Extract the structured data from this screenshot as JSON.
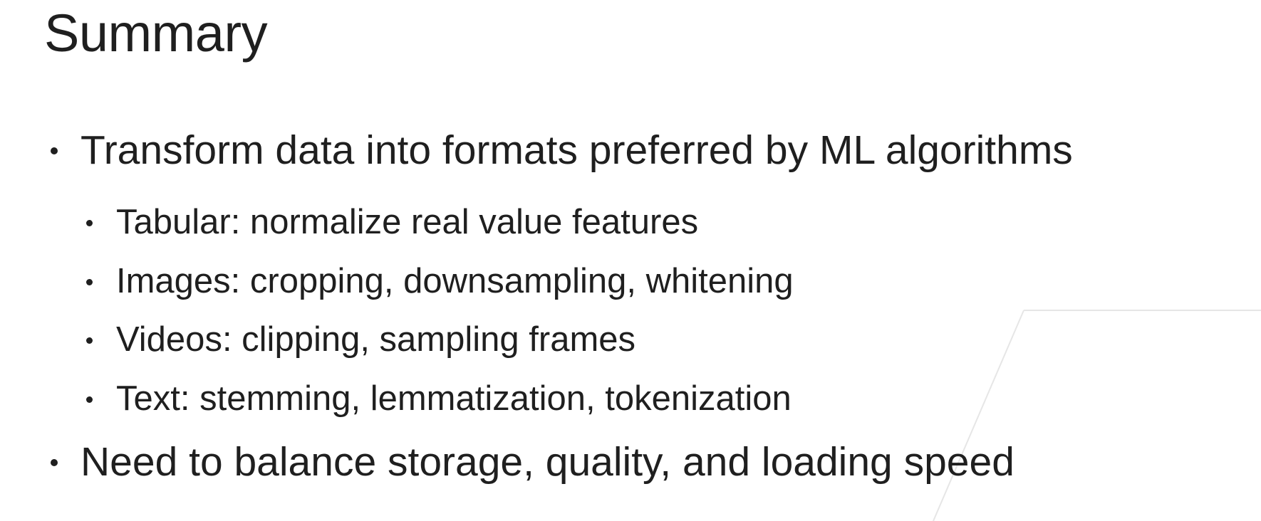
{
  "slide": {
    "title": "Summary",
    "bullets": [
      {
        "text": "Transform data into formats preferred by ML algorithms"
      },
      {
        "text": "Tabular: normalize real value features"
      },
      {
        "text": "Images: cropping, downsampling, whitening"
      },
      {
        "text": "Videos: clipping, sampling frames"
      },
      {
        "text": "Text: stemming, lemmatization, tokenization"
      },
      {
        "text": "Need to balance storage, quality, and loading speed"
      }
    ]
  }
}
